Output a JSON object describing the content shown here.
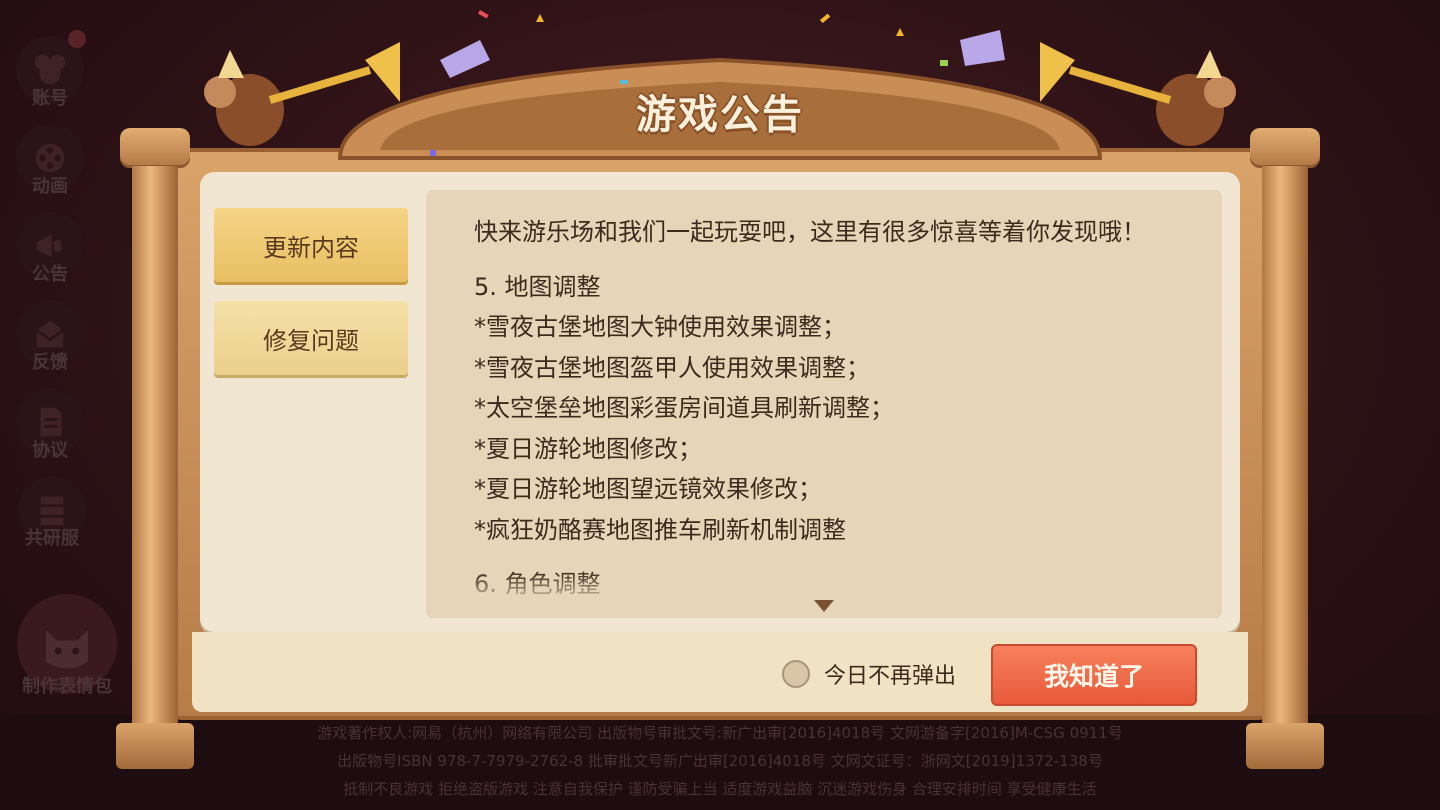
{
  "sidebar": {
    "items": [
      {
        "label": "账号",
        "icon": "mouse-avatar-icon"
      },
      {
        "label": "动画",
        "icon": "film-reel-icon"
      },
      {
        "label": "公告",
        "icon": "megaphone-icon"
      },
      {
        "label": "反馈",
        "icon": "mail-icon"
      },
      {
        "label": "协议",
        "icon": "document-icon"
      },
      {
        "label": "共研服",
        "icon": "server-icon"
      },
      {
        "label": "制作表情包",
        "icon": "cat-face-icon"
      }
    ]
  },
  "dialog": {
    "title": "游戏公告",
    "tabs": [
      {
        "label": "更新内容",
        "active": true
      },
      {
        "label": "修复问题",
        "active": false
      }
    ],
    "content": {
      "intro": "快来游乐场和我们一起玩耍吧，这里有很多惊喜等着你发现哦！",
      "section5_title": "5. 地图调整",
      "section5_items": [
        "*雪夜古堡地图大钟使用效果调整；",
        "*雪夜古堡地图盔甲人使用效果调整；",
        "*太空堡垒地图彩蛋房间道具刷新调整；",
        "*夏日游轮地图修改；",
        "*夏日游轮地图望远镜效果修改；",
        "*疯狂奶酪赛地图推车刷新机制调整"
      ],
      "section6_title": "6. 角色调整"
    },
    "dont_show_today": "今日不再弹出",
    "ok_button": "我知道了"
  },
  "footer": {
    "line1": "游戏著作权人:网易（杭州）网络有限公司 出版物号审批文号:新广出审[2016]4018号 文网游备字[2016]M-CSG 0911号",
    "line2": "出版物号ISBN 978-7-7979-2762-8  批审批文号新广出审[2016]4018号      文网文证号：浙网文[2019]1372-138号",
    "line3": "抵制不良游戏    拒绝盗版游戏    注意自我保护    谨防受骗上当    适度游戏益脑    沉迷游戏伤身    合理安排时间    享受健康生活"
  },
  "colors": {
    "accent_button": "#ee6a48",
    "tab_active": "#f2cd7a",
    "wood": "#c98d55",
    "background": "#2e1216"
  }
}
